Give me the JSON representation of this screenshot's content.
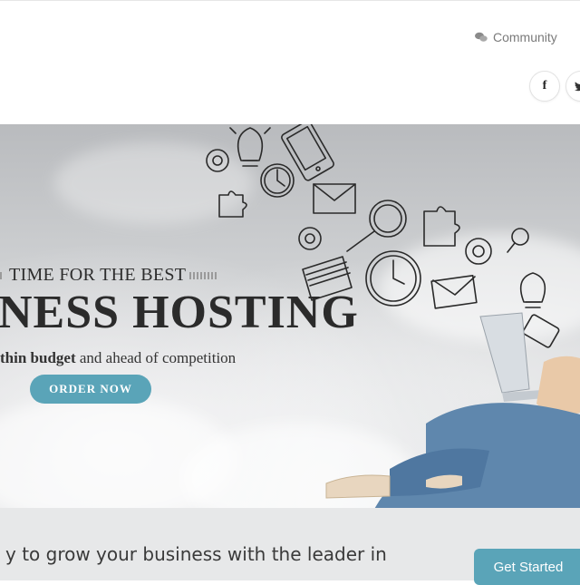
{
  "header": {
    "community_label": "Community",
    "social": {
      "facebook_glyph": "f",
      "twitter_glyph": "🐦"
    }
  },
  "hero": {
    "eyebrow": "TIME FOR THE BEST",
    "title": "NESS HOSTING",
    "subtitle_bold": "thin budget",
    "subtitle_rest": " and ahead of competition",
    "order_button": "ORDER NOW"
  },
  "cta": {
    "text": "y to grow your business with the leader in",
    "button": "Get Started"
  },
  "colors": {
    "accent": "#5aa4b8",
    "band": "#e7e8e9"
  },
  "icons": [
    "comments-icon",
    "facebook-icon",
    "twitter-icon",
    "lightbulb-icon",
    "smartphone-icon",
    "clock-icon",
    "envelope-icon",
    "at-sign-icon",
    "puzzle-icon",
    "magnifier-icon",
    "book-icon",
    "laptop-icon"
  ]
}
